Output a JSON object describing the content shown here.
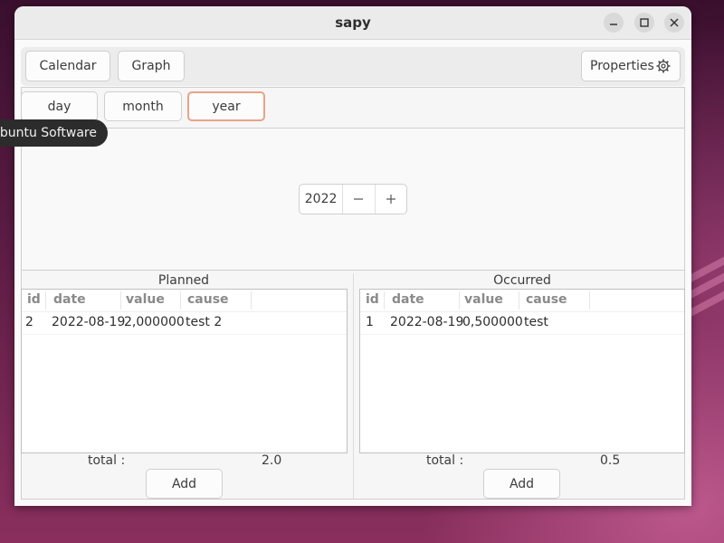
{
  "window": {
    "title": "sapy"
  },
  "toolbar": {
    "calendar_label": "Calendar",
    "graph_label": "Graph",
    "properties_label": "Properties"
  },
  "period_tabs": {
    "day": "day",
    "month": "month",
    "year": "year",
    "selected": "year"
  },
  "year_spin": {
    "value": "2022"
  },
  "planned": {
    "label": "Planned",
    "columns": [
      "id",
      "date",
      "value",
      "cause"
    ],
    "rows": [
      {
        "id": "2",
        "date": "2022-08-19",
        "value": "2,000000",
        "cause": "test 2"
      }
    ],
    "total_label": "total :",
    "total_value": "2.0",
    "add_label": "Add"
  },
  "occurred": {
    "label": "Occurred",
    "columns": [
      "id",
      "date",
      "value",
      "cause"
    ],
    "rows": [
      {
        "id": "1",
        "date": "2022-08-19",
        "value": "0,500000",
        "cause": "test"
      }
    ],
    "total_label": "total :",
    "total_value": "0.5",
    "add_label": "Add"
  },
  "tooltip": {
    "text": "Ubuntu Software"
  },
  "icons": {
    "minimize": "minimize-icon",
    "maximize": "maximize-icon",
    "close": "close-icon",
    "settings": "gear-icon",
    "decrement": "minus-icon",
    "increment": "plus-icon"
  },
  "colors": {
    "selected_tab_border": "#e9a484",
    "tooltip_bg": "#2c2c2c",
    "window_bg": "#fafafa"
  }
}
